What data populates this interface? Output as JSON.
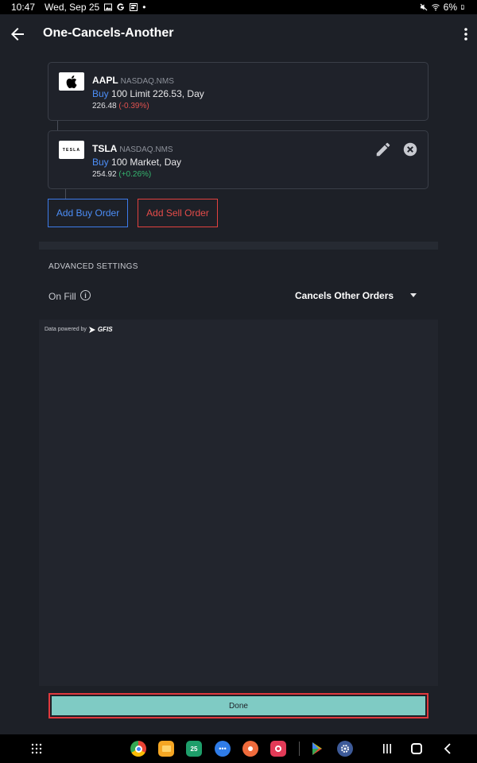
{
  "status_bar": {
    "time": "10:47",
    "date": "Wed, Sep 25",
    "dot": "•",
    "battery": "6%",
    "icons": [
      "image-icon",
      "google-g-icon",
      "gallery-icon",
      "mute-icon",
      "wifi-icon",
      "battery-icon"
    ]
  },
  "app_bar": {
    "title": "One-Cancels-Another",
    "icons": [
      "back-arrow-icon",
      "more-vert-icon"
    ]
  },
  "orders": [
    {
      "symbol": "AAPL",
      "exchange": "NASDAQ.NMS",
      "side": "Buy",
      "details": " 100 Limit 226.53, Day",
      "price": "226.48",
      "change": "(-0.39%)",
      "change_direction": "negative",
      "logo_icon": "apple-logo-icon"
    },
    {
      "symbol": "TSLA",
      "exchange": "NASDAQ.NMS",
      "side": "Buy",
      "details": " 100 Market, Day",
      "price": "254.92",
      "change": "(+0.26%)",
      "change_direction": "positive",
      "logo_icon": "tesla-logo-icon",
      "logo_text": "TESLA",
      "actions": [
        "edit-icon",
        "remove-circle-icon"
      ]
    }
  ],
  "buttons": {
    "add_buy": "Add Buy Order",
    "add_sell": "Add Sell Order",
    "done": "Done"
  },
  "advanced": {
    "title": "ADVANCED SETTINGS",
    "on_fill_label": "On Fill",
    "info_glyph": "i",
    "on_fill_value": "Cancels Other Orders"
  },
  "data_panel": {
    "powered_by": "Data powered by",
    "provider": "GFIS"
  },
  "dock": {
    "date_badge": "25",
    "apps": [
      "chrome-icon",
      "files-icon",
      "calendar-icon",
      "messages-icon",
      "contacts-icon",
      "camera-icon",
      "play-store-icon",
      "settings-icon"
    ]
  },
  "colors": {
    "background": "#1d2027",
    "buy_blue": "#4c8ef7",
    "sell_red": "#e54c4a",
    "negative": "#e0514f",
    "positive": "#35b66f",
    "done_teal": "#7fcbc4",
    "highlight_red": "#e0393e"
  }
}
